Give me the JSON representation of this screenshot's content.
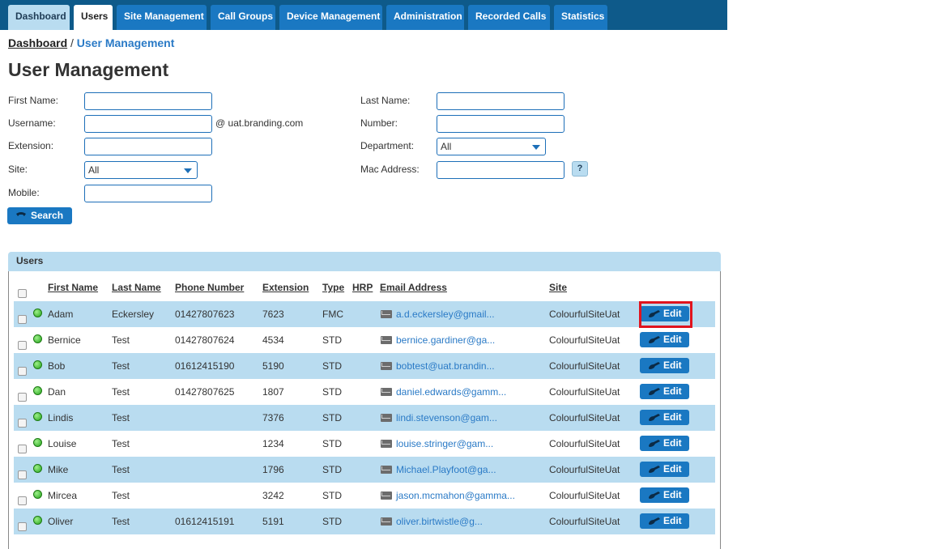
{
  "nav": {
    "tabs": [
      {
        "label": "Dashboard"
      },
      {
        "label": "Users"
      },
      {
        "label": "Site Management"
      },
      {
        "label": "Call Groups"
      },
      {
        "label": "Device Management"
      },
      {
        "label": "Administration"
      },
      {
        "label": "Recorded Calls"
      },
      {
        "label": "Statistics"
      }
    ],
    "active": "Users"
  },
  "breadcrumb": {
    "root": "Dashboard",
    "separator": " / ",
    "current": "User Management"
  },
  "page_title": "User Management",
  "form": {
    "first_name": {
      "label": "First Name:",
      "value": ""
    },
    "last_name": {
      "label": "Last Name:",
      "value": ""
    },
    "username": {
      "label": "Username:",
      "value": "",
      "suffix": "@ uat.branding.com"
    },
    "number": {
      "label": "Number:",
      "value": ""
    },
    "extension": {
      "label": "Extension:",
      "value": ""
    },
    "department": {
      "label": "Department:",
      "selected": "All"
    },
    "site": {
      "label": "Site:",
      "selected": "All"
    },
    "mac_address": {
      "label": "Mac Address:",
      "value": "",
      "help": "?"
    },
    "mobile": {
      "label": "Mobile:",
      "value": ""
    },
    "search_label": "Search"
  },
  "users_panel": {
    "title": "Users",
    "columns": [
      "First Name",
      "Last Name",
      "Phone Number",
      "Extension",
      "Type",
      "HRP",
      "Email Address",
      "Site"
    ],
    "edit_label": "Edit",
    "rows": [
      {
        "first": "Adam",
        "last": "Eckersley",
        "phone": "01427807623",
        "ext": "7623",
        "type": "FMC",
        "email": "a.d.eckersley@gmail...",
        "site": "ColourfulSiteUat"
      },
      {
        "first": "Bernice",
        "last": "Test",
        "phone": "01427807624",
        "ext": "4534",
        "type": "STD",
        "email": "bernice.gardiner@ga...",
        "site": "ColourfulSiteUat"
      },
      {
        "first": "Bob",
        "last": "Test",
        "phone": "01612415190",
        "ext": "5190",
        "type": "STD",
        "email": "bobtest@uat.brandin...",
        "site": "ColourfulSiteUat"
      },
      {
        "first": "Dan",
        "last": "Test",
        "phone": "01427807625",
        "ext": "1807",
        "type": "STD",
        "email": "daniel.edwards@gamm...",
        "site": "ColourfulSiteUat"
      },
      {
        "first": "Lindis",
        "last": "Test",
        "phone": "",
        "ext": "7376",
        "type": "STD",
        "email": "lindi.stevenson@gam...",
        "site": "ColourfulSiteUat"
      },
      {
        "first": "Louise",
        "last": "Test",
        "phone": "",
        "ext": "1234",
        "type": "STD",
        "email": "louise.stringer@gam...",
        "site": "ColourfulSiteUat"
      },
      {
        "first": "Mike",
        "last": "Test",
        "phone": "",
        "ext": "1796",
        "type": "STD",
        "email": "Michael.Playfoot@ga...",
        "site": "ColourfulSiteUat"
      },
      {
        "first": "Mircea",
        "last": "Test",
        "phone": "",
        "ext": "3242",
        "type": "STD",
        "email": "jason.mcmahon@gamma...",
        "site": "ColourfulSiteUat"
      },
      {
        "first": "Oliver",
        "last": "Test",
        "phone": "01612415191",
        "ext": "5191",
        "type": "STD",
        "email": "oliver.birtwistle@g...",
        "site": "ColourfulSiteUat"
      }
    ]
  },
  "colors": {
    "nav_bar": "#0e5a8a",
    "tab": "#1a78c2",
    "row_highlight": "#b9dcf0",
    "link": "#2a7ac6",
    "focus_outline": "#e0141e",
    "status_online": "#26a51c"
  }
}
